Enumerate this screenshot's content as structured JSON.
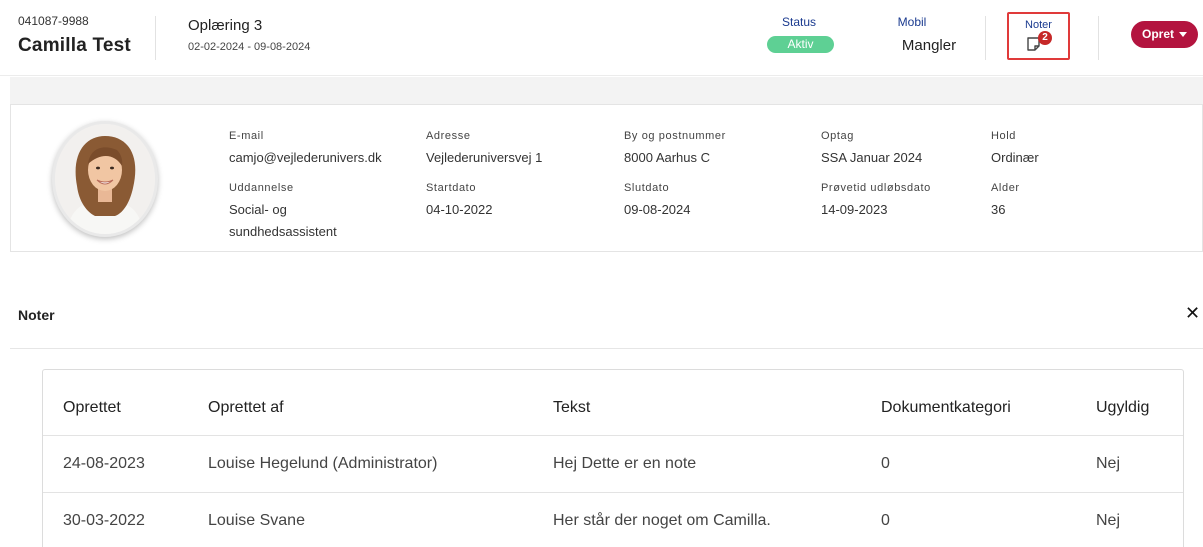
{
  "header": {
    "cpr": "041087-9988",
    "person_name": "Camilla Test",
    "course_title": "Oplæring 3",
    "course_dates": "02-02-2024 - 09-08-2024",
    "status_label": "Status",
    "status_value": "Aktiv",
    "mobile_label": "Mobil",
    "mobile_value": "Mangler",
    "notes_label": "Noter",
    "notes_count": "2",
    "create_label": "Opret",
    "colors": {
      "brand": "#b3143f",
      "status": "#5ed094",
      "label": "#1a3a8f",
      "badge": "#c62828",
      "highlight": "#e03a3a"
    }
  },
  "profile": {
    "avatar_icon": "person-avatar",
    "fields": {
      "email": {
        "label": "E-mail",
        "value": "camjo@vejlederunivers.dk"
      },
      "address": {
        "label": "Adresse",
        "value": "Vejlederuniversvej 1"
      },
      "city": {
        "label": "By og postnummer",
        "value": "8000 Aarhus C"
      },
      "intake": {
        "label": "Optag",
        "value": "SSA Januar 2024"
      },
      "team": {
        "label": "Hold",
        "value": "Ordinær"
      },
      "education": {
        "label": "Uddannelse",
        "value_line1": "Social- og",
        "value_line2": "sundhedsassistent"
      },
      "start": {
        "label": "Startdato",
        "value": "04-10-2022"
      },
      "end": {
        "label": "Slutdato",
        "value": "09-08-2024"
      },
      "probation": {
        "label": "Prøvetid udløbsdato",
        "value": "14-09-2023"
      },
      "age": {
        "label": "Alder",
        "value": "36"
      }
    }
  },
  "notes_section": {
    "title": "Noter",
    "close_icon": "close-icon",
    "columns": [
      "Oprettet",
      "Oprettet af",
      "Tekst",
      "Dokumentkategori",
      "Ugyldig"
    ],
    "rows": [
      [
        "24-08-2023",
        "Louise Hegelund (Administrator)",
        "Hej Dette er en note",
        "0",
        "Nej"
      ],
      [
        "30-03-2022",
        "Louise Svane",
        "Her står der noget om Camilla.",
        "0",
        "Nej"
      ]
    ]
  }
}
